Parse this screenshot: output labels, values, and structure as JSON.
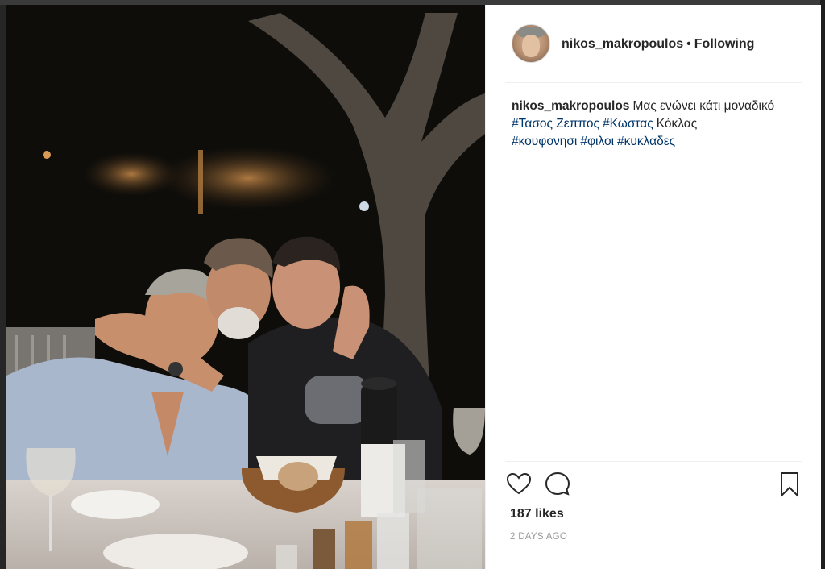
{
  "header": {
    "username": "nikos_makropoulos",
    "separator": "•",
    "follow_status": "Following"
  },
  "caption": {
    "username": "nikos_makropoulos",
    "text": "Μας ενώνει κάτι μοναδικό",
    "hashtags": [
      "#Τασος Ζεππος",
      "#Κωστας",
      "#κουφονησι",
      "#φιλοι",
      "#κυκλαδες"
    ],
    "plain_after_tag": "Κόκλας"
  },
  "actions": {
    "icons": [
      "heart-icon",
      "comment-icon",
      "bookmark-icon"
    ]
  },
  "likes": "187 likes",
  "timestamp": "2 DAYS AGO",
  "colors": {
    "hashtag": "#003569",
    "text": "#262626",
    "muted": "#999999"
  }
}
